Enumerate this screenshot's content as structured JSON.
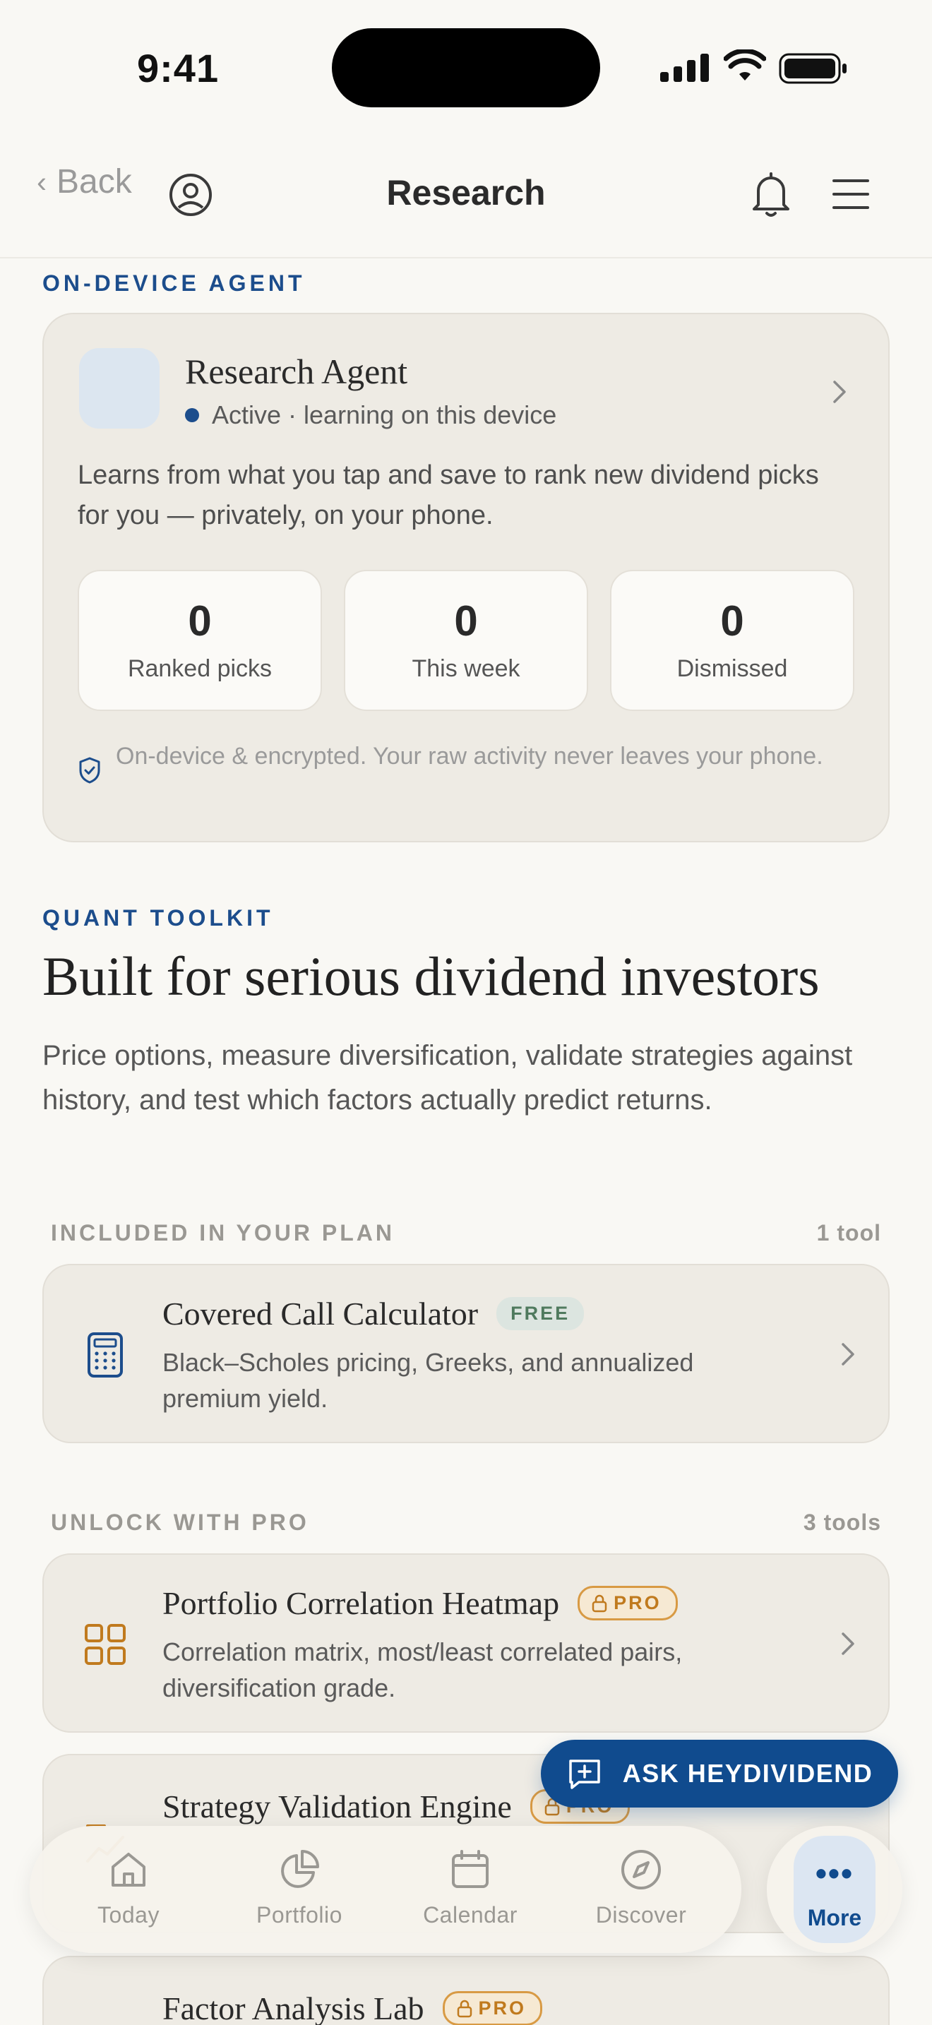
{
  "status_bar": {
    "time": "9:41"
  },
  "nav": {
    "back_label": "Back",
    "title": "Research"
  },
  "agent_section": {
    "eyebrow": "ON-DEVICE AGENT",
    "name": "Research Agent",
    "status": "Active · learning on this device",
    "description": "Learns from what you tap and save to rank new dividend picks for you — privately, on your phone.",
    "stats": [
      {
        "value": "0",
        "label": "Ranked picks"
      },
      {
        "value": "0",
        "label": "This week"
      },
      {
        "value": "0",
        "label": "Dismissed"
      }
    ],
    "privacy_note": "On-device & encrypted. Your raw activity never leaves your phone."
  },
  "toolkit": {
    "eyebrow": "QUANT TOOLKIT",
    "headline": "Built for serious dividend investors",
    "subtext": "Price options, measure diversification, validate strategies against history, and test which factors actually predict returns."
  },
  "included": {
    "label": "INCLUDED IN YOUR PLAN",
    "count": "1 tool",
    "tools": [
      {
        "title": "Covered Call Calculator",
        "badge": "FREE",
        "description": "Black–Scholes pricing, Greeks, and annualized premium yield.",
        "icon": "calculator-icon"
      }
    ]
  },
  "pro": {
    "label": "UNLOCK WITH PRO",
    "count": "3 tools",
    "tools": [
      {
        "title": "Portfolio Correlation Heatmap",
        "badge": "PRO",
        "description": "Correlation matrix, most/least correlated pairs, diversification grade.",
        "icon": "grid-icon"
      },
      {
        "title": "Strategy Validation Engine",
        "badge": "PRO",
        "icon": "chart-icon"
      },
      {
        "title": "Factor Analysis Lab",
        "badge": "PRO"
      }
    ]
  },
  "ask_button": {
    "label": "ASK HEYDIVIDEND"
  },
  "tabbar": {
    "tabs": [
      {
        "label": "Today",
        "icon": "home-icon"
      },
      {
        "label": "Portfolio",
        "icon": "pie-chart-icon"
      },
      {
        "label": "Calendar",
        "icon": "calendar-icon"
      },
      {
        "label": "Discover",
        "icon": "compass-icon"
      }
    ],
    "more": {
      "label": "More",
      "dots": "•••",
      "icon": "more-icon"
    }
  },
  "colors": {
    "accent": "#104B8E",
    "pro": "#C07A1E",
    "free": "#4F7A5E",
    "background": "#F9F8F4",
    "card": "#EEEBE4"
  }
}
